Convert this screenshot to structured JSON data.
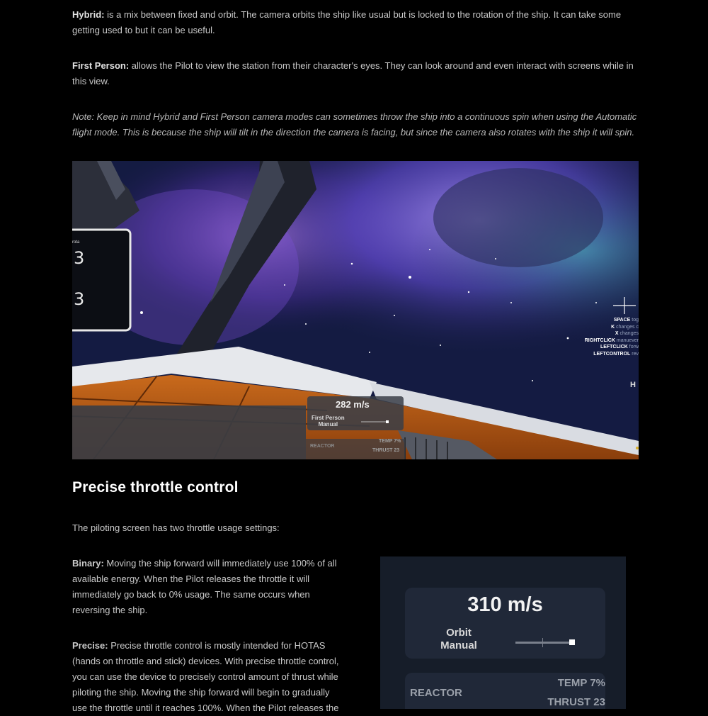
{
  "hybrid": {
    "term": "Hybrid:",
    "text": " is a mix between fixed and orbit. The camera orbits the ship like usual but is locked to the rotation of the ship. It can take some getting used to but it can be useful."
  },
  "first_person": {
    "term": "First Person:",
    "text": " allows the Pilot to view the station from their character's eyes. They can look around and even interact with screens while in this view."
  },
  "note": "Note: Keep in mind Hybrid and First Person camera modes can sometimes throw the ship into a continuous spin when using the Automatic flight mode. This is because the ship will tilt in the direction the camera is facing, but since the camera also rotates with the ship it will spin.",
  "screenshot1": {
    "speed": "282 m/s",
    "mode_line1": "First Person",
    "mode_line2": "Manual",
    "reactor": "REACTOR",
    "temp": "TEMP 7%",
    "thrust": "THRUST 23",
    "panel_label": "rota",
    "keys": [
      {
        "key": "SPACE",
        "desc": " tog"
      },
      {
        "key": "K",
        "desc": " changes c"
      },
      {
        "key": "X",
        "desc": " changes"
      },
      {
        "key": "RIGHTCLICK",
        "desc": " manuever"
      },
      {
        "key": "LEFTCLICK",
        "desc": " forw"
      },
      {
        "key": "LEFTCONTROL",
        "desc": " rev"
      }
    ]
  },
  "section_heading": "Precise throttle control",
  "intro": "The piloting screen has two throttle usage settings:",
  "binary": {
    "term": "Binary:",
    "text": " Moving the ship forward will immediately use 100% of all available energy. When the Pilot releases the throttle it will immediately go back to 0% usage. The same occurs when reversing the ship."
  },
  "precise": {
    "term": "Precise:",
    "text": " Precise throttle control is mostly intended for HOTAS (hands on throttle and stick) devices. With precise throttle control, you can use the device to precisely control amount of thrust while piloting the ship. Moving the ship forward will begin to gradually use the throttle until it reaches 100%. When the Pilot releases the"
  },
  "screenshot2": {
    "speed": "310 m/s",
    "mode_line1": "Orbit",
    "mode_line2": "Manual",
    "reactor": "REACTOR",
    "temp": "TEMP 7%",
    "thrust": "THRUST 23"
  }
}
